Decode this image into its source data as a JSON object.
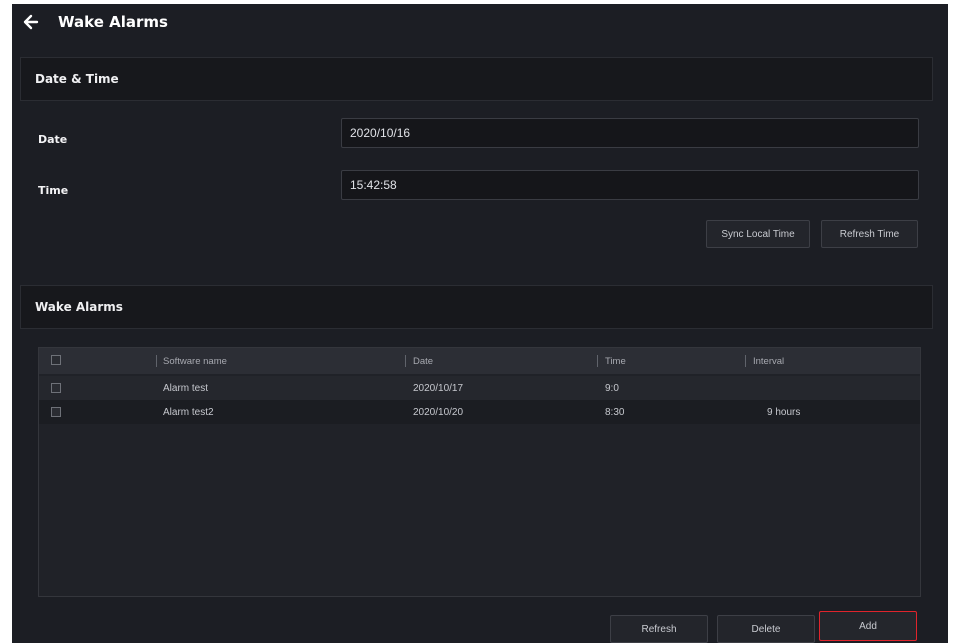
{
  "header": {
    "title": "Wake Alarms"
  },
  "date_time": {
    "title": "Date & Time",
    "date_label": "Date",
    "date_value": "2020/10/16",
    "time_label": "Time",
    "time_value": "15:42:58",
    "sync_button": "Sync Local Time",
    "refresh_button": "Refresh Time"
  },
  "wake_alarms": {
    "title": "Wake Alarms",
    "columns": [
      "Software name",
      "Date",
      "Time",
      "Interval"
    ],
    "rows": [
      {
        "name": "Alarm test",
        "date": "2020/10/17",
        "time": "9:0",
        "interval": ""
      },
      {
        "name": "Alarm test2",
        "date": "2020/10/20",
        "time": "8:30",
        "interval": "9 hours"
      }
    ]
  },
  "footer": {
    "refresh": "Refresh",
    "delete": "Delete",
    "add": "Add"
  },
  "colors": {
    "background": "#1c1e24",
    "panel_header": "#17181c",
    "accent_border": "#e0242c"
  },
  "icons": {
    "back": "arrow-left-icon"
  }
}
